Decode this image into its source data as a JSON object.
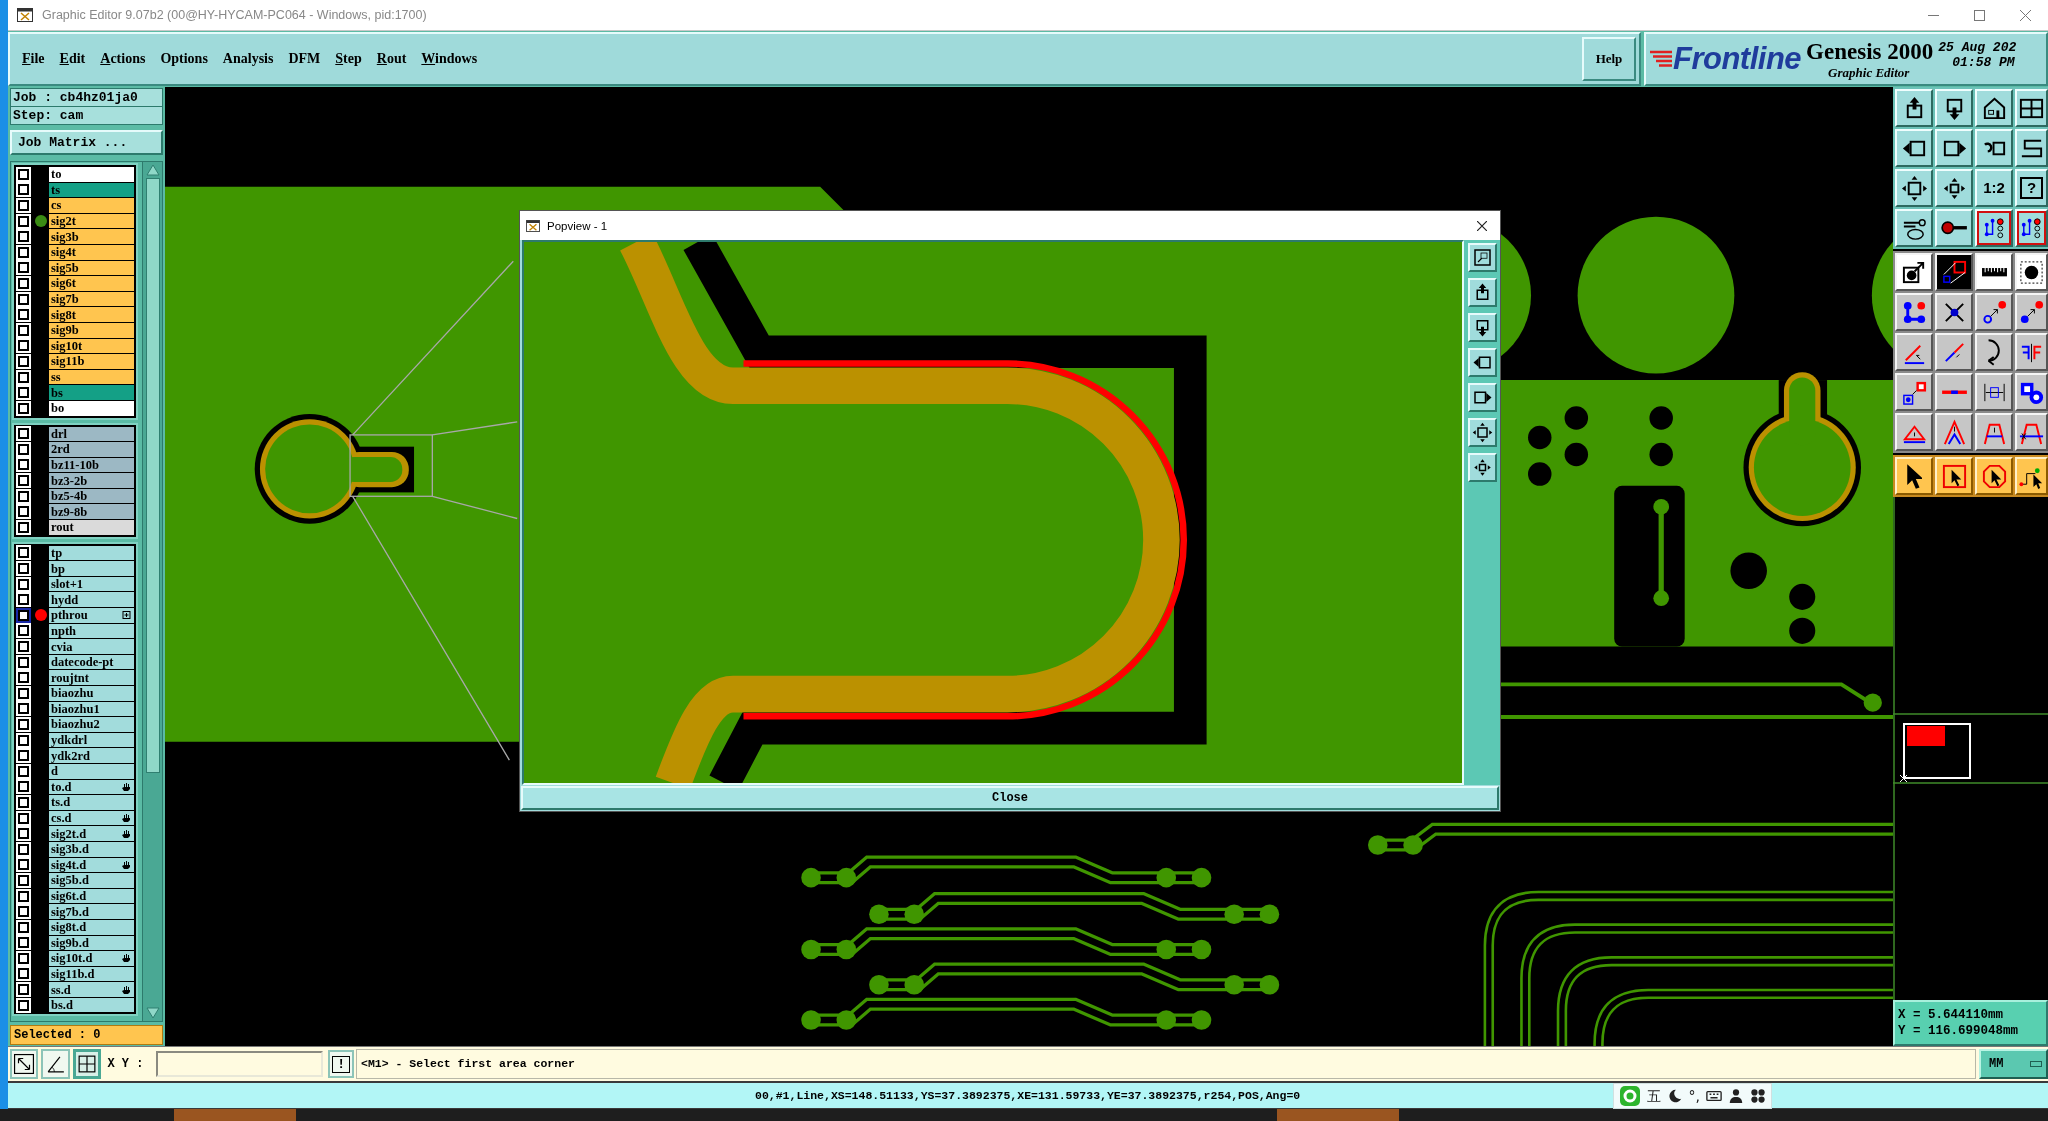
{
  "window": {
    "title": "Graphic Editor 9.07b2 (00@HY-HYCAM-PC064 - Windows, pid:1700)"
  },
  "menu": [
    {
      "label": "File",
      "mnemonic": true
    },
    {
      "label": "Edit",
      "mnemonic": true
    },
    {
      "label": "Actions",
      "mnemonic": true
    },
    {
      "label": "Options",
      "mnemonic": false
    },
    {
      "label": "Analysis",
      "mnemonic": false
    },
    {
      "label": "DFM",
      "mnemonic": false
    },
    {
      "label": "Step",
      "mnemonic": true
    },
    {
      "label": "Rout",
      "mnemonic": true
    },
    {
      "label": "Windows",
      "mnemonic": true
    }
  ],
  "help": "Help",
  "brand": {
    "logo": "Frontline",
    "product": "Genesis 2000",
    "subtitle": "Graphic Editor",
    "date": "25 Aug 202",
    "time": "01:58 PM"
  },
  "job": {
    "job": "Job : cb4hz01ja0",
    "step": "Step: cam",
    "matrix_button": "Job Matrix ..."
  },
  "layer_groups": [
    {
      "layers": [
        {
          "name": "to",
          "color": "#ffffff",
          "checked": false,
          "focused": false,
          "linked": false,
          "expandable": false
        },
        {
          "name": "ts",
          "color": "#14a086",
          "checked": false,
          "focused": false,
          "linked": false,
          "expandable": false
        },
        {
          "name": "cs",
          "color": "#ffc54f",
          "checked": false,
          "focused": false,
          "linked": false,
          "expandable": false
        },
        {
          "name": "sig2t",
          "color": "#ffc54f",
          "checked": false,
          "focused": false,
          "linked": false,
          "expandable": false,
          "dot": {
            "color": "#3a8c14"
          }
        },
        {
          "name": "sig3b",
          "color": "#ffc54f",
          "checked": false,
          "focused": false,
          "linked": false,
          "expandable": false
        },
        {
          "name": "sig4t",
          "color": "#ffc54f",
          "checked": false,
          "focused": false,
          "linked": false,
          "expandable": false
        },
        {
          "name": "sig5b",
          "color": "#ffc54f",
          "checked": false,
          "focused": false,
          "linked": false,
          "expandable": false
        },
        {
          "name": "sig6t",
          "color": "#ffc54f",
          "checked": false,
          "focused": false,
          "linked": false,
          "expandable": false
        },
        {
          "name": "sig7b",
          "color": "#ffc54f",
          "checked": false,
          "focused": false,
          "linked": false,
          "expandable": false
        },
        {
          "name": "sig8t",
          "color": "#ffc54f",
          "checked": false,
          "focused": false,
          "linked": false,
          "expandable": false
        },
        {
          "name": "sig9b",
          "color": "#ffc54f",
          "checked": false,
          "focused": false,
          "linked": false,
          "expandable": false
        },
        {
          "name": "sig10t",
          "color": "#ffc54f",
          "checked": false,
          "focused": false,
          "linked": false,
          "expandable": false
        },
        {
          "name": "sig11b",
          "color": "#ffc54f",
          "checked": false,
          "focused": false,
          "linked": false,
          "expandable": false
        },
        {
          "name": "ss",
          "color": "#ffc54f",
          "checked": false,
          "focused": false,
          "linked": false,
          "expandable": false
        },
        {
          "name": "bs",
          "color": "#14a086",
          "checked": false,
          "focused": false,
          "linked": false,
          "expandable": false
        },
        {
          "name": "bo",
          "color": "#ffffff",
          "checked": false,
          "focused": false,
          "linked": false,
          "expandable": false
        }
      ]
    },
    {
      "layers": [
        {
          "name": "drl",
          "color": "#9cb8c4",
          "checked": false,
          "focused": false,
          "linked": false,
          "expandable": false
        },
        {
          "name": "2rd",
          "color": "#9cb8c4",
          "checked": false,
          "focused": false,
          "linked": false,
          "expandable": false
        },
        {
          "name": "bz11-10b",
          "color": "#9cb8c4",
          "checked": false,
          "focused": false,
          "linked": false,
          "expandable": false
        },
        {
          "name": "bz3-2b",
          "color": "#9cb8c4",
          "checked": false,
          "focused": false,
          "linked": false,
          "expandable": false
        },
        {
          "name": "bz5-4b",
          "color": "#9cb8c4",
          "checked": false,
          "focused": false,
          "linked": false,
          "expandable": false
        },
        {
          "name": "bz9-8b",
          "color": "#9cb8c4",
          "checked": false,
          "focused": false,
          "linked": false,
          "expandable": false
        },
        {
          "name": "rout",
          "color": "#dadada",
          "checked": false,
          "focused": false,
          "linked": false,
          "expandable": false
        }
      ]
    },
    {
      "layers": [
        {
          "name": "tp",
          "color": "#a2dcdc",
          "checked": false,
          "focused": false,
          "linked": false,
          "expandable": false
        },
        {
          "name": "bp",
          "color": "#a2dcdc",
          "checked": false,
          "focused": false,
          "linked": false,
          "expandable": false
        },
        {
          "name": "slot+1",
          "color": "#a2dcdc",
          "checked": false,
          "focused": false,
          "linked": false,
          "expandable": false
        },
        {
          "name": "hydd",
          "color": "#a2dcdc",
          "checked": false,
          "focused": false,
          "linked": false,
          "expandable": false
        },
        {
          "name": "pthrou",
          "color": "#a2dcdc",
          "checked": false,
          "focused": true,
          "linked": false,
          "expandable": true,
          "dot": {
            "color": "#ff0000"
          }
        },
        {
          "name": "npth",
          "color": "#a2dcdc",
          "checked": false,
          "focused": false,
          "linked": false,
          "expandable": false
        },
        {
          "name": "cvia",
          "color": "#a2dcdc",
          "checked": false,
          "focused": false,
          "linked": false,
          "expandable": false
        },
        {
          "name": "datecode-pt",
          "color": "#a2dcdc",
          "checked": false,
          "focused": false,
          "linked": false,
          "expandable": false
        },
        {
          "name": "roujtnt",
          "color": "#a2dcdc",
          "checked": false,
          "focused": false,
          "linked": false,
          "expandable": false
        },
        {
          "name": "biaozhu",
          "color": "#a2dcdc",
          "checked": false,
          "focused": false,
          "linked": false,
          "expandable": false
        },
        {
          "name": "biaozhu1",
          "color": "#a2dcdc",
          "checked": false,
          "focused": false,
          "linked": false,
          "expandable": false
        },
        {
          "name": "biaozhu2",
          "color": "#a2dcdc",
          "checked": false,
          "focused": false,
          "linked": false,
          "expandable": false
        },
        {
          "name": "ydkdrl",
          "color": "#a2dcdc",
          "checked": false,
          "focused": false,
          "linked": false,
          "expandable": false
        },
        {
          "name": "ydk2rd",
          "color": "#a2dcdc",
          "checked": false,
          "focused": false,
          "linked": false,
          "expandable": false
        },
        {
          "name": "d",
          "color": "#a2dcdc",
          "checked": false,
          "focused": false,
          "linked": false,
          "expandable": false
        },
        {
          "name": "to.d",
          "color": "#a2dcdc",
          "checked": false,
          "focused": false,
          "linked": true,
          "expandable": false
        },
        {
          "name": "ts.d",
          "color": "#a2dcdc",
          "checked": false,
          "focused": false,
          "linked": false,
          "expandable": false
        },
        {
          "name": "cs.d",
          "color": "#a2dcdc",
          "checked": false,
          "focused": false,
          "linked": true,
          "expandable": false
        },
        {
          "name": "sig2t.d",
          "color": "#a2dcdc",
          "checked": false,
          "focused": false,
          "linked": true,
          "expandable": false
        },
        {
          "name": "sig3b.d",
          "color": "#a2dcdc",
          "checked": false,
          "focused": false,
          "linked": false,
          "expandable": false
        },
        {
          "name": "sig4t.d",
          "color": "#a2dcdc",
          "checked": false,
          "focused": false,
          "linked": true,
          "expandable": false
        },
        {
          "name": "sig5b.d",
          "color": "#a2dcdc",
          "checked": false,
          "focused": false,
          "linked": false,
          "expandable": false
        },
        {
          "name": "sig6t.d",
          "color": "#a2dcdc",
          "checked": false,
          "focused": false,
          "linked": false,
          "expandable": false
        },
        {
          "name": "sig7b.d",
          "color": "#a2dcdc",
          "checked": false,
          "focused": false,
          "linked": false,
          "expandable": false
        },
        {
          "name": "sig8t.d",
          "color": "#a2dcdc",
          "checked": false,
          "focused": false,
          "linked": false,
          "expandable": false
        },
        {
          "name": "sig9b.d",
          "color": "#a2dcdc",
          "checked": false,
          "focused": false,
          "linked": false,
          "expandable": false
        },
        {
          "name": "sig10t.d",
          "color": "#a2dcdc",
          "checked": false,
          "focused": false,
          "linked": true,
          "expandable": false
        },
        {
          "name": "sig11b.d",
          "color": "#a2dcdc",
          "checked": false,
          "focused": false,
          "linked": false,
          "expandable": false
        },
        {
          "name": "ss.d",
          "color": "#a2dcdc",
          "checked": false,
          "focused": false,
          "linked": true,
          "expandable": false
        },
        {
          "name": "bs.d",
          "color": "#a2dcdc",
          "checked": false,
          "focused": false,
          "linked": false,
          "expandable": false
        }
      ]
    }
  ],
  "selected_count": "Selected : 0",
  "popview": {
    "title": "Popview - 1",
    "close_button": "Close"
  },
  "toolbar": {
    "ratio_button": "1:2",
    "help_button": "?"
  },
  "coordinates": {
    "x": "X = 5.644110mm",
    "y": "Y = 116.699048mm"
  },
  "command": {
    "tools": [
      {
        "selected": false
      },
      {
        "selected": false
      },
      {
        "selected": true
      }
    ],
    "label": "X Y :",
    "exec_button": "!",
    "message": "<M1> - Select first area corner",
    "units": "MM"
  },
  "status": "00,#1,Line,XS=148.51133,YS=37.3892375,XE=131.59733,YE=37.3892375,r254,POS,Ang=0",
  "ime": {
    "mode": "五",
    "punct": "°,"
  }
}
